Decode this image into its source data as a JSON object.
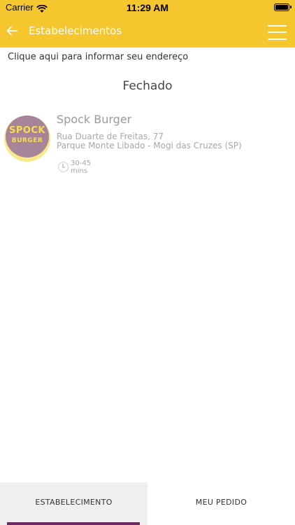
{
  "status_bar": {
    "carrier": "Carrier",
    "time": "11:29 AM",
    "wifi_icon": "wifi-icon",
    "battery_icon": "battery-icon"
  },
  "nav": {
    "title": "Estabelecimentos",
    "back_icon": "arrow-left-icon",
    "menu_icon": "hamburger-menu-icon"
  },
  "address_prompt": "Clique aqui para informar seu endereço",
  "section_status": "Fechado",
  "store": {
    "logo_line1": "SPOCK",
    "logo_line2": "BURGER",
    "name": "Spock Burger",
    "address_line1": "Rua Duarte de Freitas, 77",
    "address_line2": "Parque Monte Libado - Mogi das Cruzes (SP)",
    "delivery_time": "30-45",
    "delivery_unit": "mins",
    "clock_icon": "clock-icon"
  },
  "tabs": [
    {
      "label": "ESTABELECIMENTO",
      "active": true
    },
    {
      "label": "MEU PEDIDO",
      "active": false
    }
  ],
  "colors": {
    "header": "#f5c62e",
    "tab_indicator": "#6a2c5f",
    "logo_purple": "#a8849a",
    "logo_yellow": "#f6df4a"
  }
}
